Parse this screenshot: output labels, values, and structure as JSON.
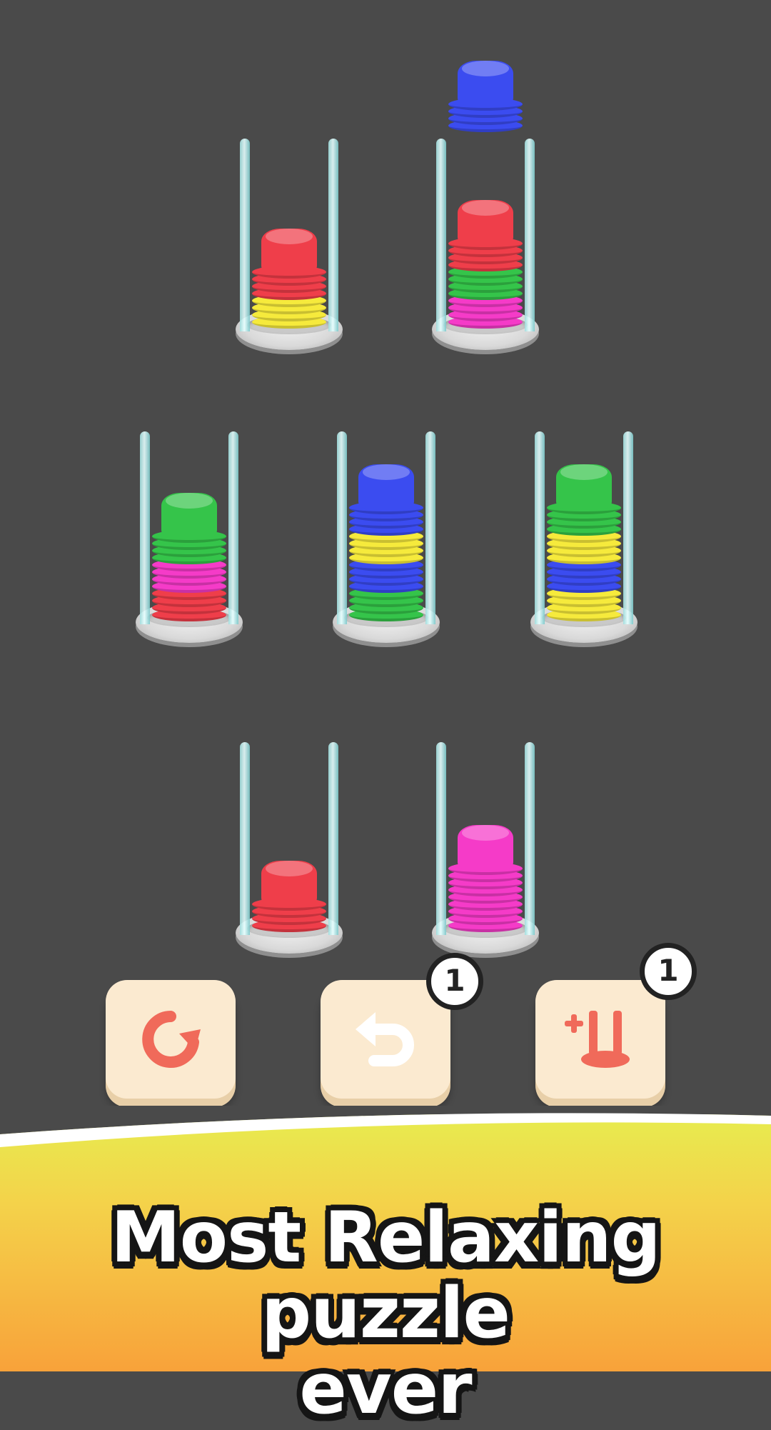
{
  "tagline": {
    "line1": "Most Relaxing puzzle",
    "line2": "ever"
  },
  "controls": {
    "restart_icon": "restart-icon",
    "undo_icon": "undo-icon",
    "undo_badge": "1",
    "add_tube_icon": "add-tube-icon",
    "add_tube_badge": "1"
  },
  "colors": {
    "background": "#4a4a4a",
    "red": "#ef3e4a",
    "yellow": "#f6ea3c",
    "green": "#35c44a",
    "magenta": "#f53bc8",
    "blue": "#3b4cf0",
    "button": "#fbead0",
    "icon": "#f06a5a"
  },
  "tubes": [
    {
      "id": "tube-1",
      "cups": [
        "yellow",
        "yellow",
        "yellow",
        "yellow",
        "red",
        "red",
        "red",
        "red"
      ]
    },
    {
      "id": "tube-2",
      "cups": [
        "magenta",
        "magenta",
        "magenta",
        "magenta",
        "green",
        "green",
        "green",
        "green",
        "red",
        "red",
        "red",
        "red"
      ]
    },
    {
      "id": "tube-3",
      "cups": [
        "red",
        "red",
        "red",
        "red",
        "magenta",
        "magenta",
        "magenta",
        "magenta",
        "green",
        "green",
        "green",
        "green"
      ]
    },
    {
      "id": "tube-4",
      "cups": [
        "green",
        "green",
        "green",
        "green",
        "blue",
        "blue",
        "blue",
        "blue",
        "yellow",
        "yellow",
        "yellow",
        "yellow",
        "blue",
        "blue",
        "blue",
        "blue"
      ]
    },
    {
      "id": "tube-5",
      "cups": [
        "yellow",
        "yellow",
        "yellow",
        "yellow",
        "blue",
        "blue",
        "blue",
        "blue",
        "yellow",
        "yellow",
        "yellow",
        "yellow",
        "green",
        "green",
        "green",
        "green"
      ]
    },
    {
      "id": "tube-6",
      "cups": [
        "red",
        "red",
        "red",
        "red"
      ]
    },
    {
      "id": "tube-7",
      "cups": [
        "magenta",
        "magenta",
        "magenta",
        "magenta",
        "magenta",
        "magenta",
        "magenta",
        "magenta",
        "magenta"
      ]
    }
  ],
  "held_stack": {
    "id": "held-stack",
    "cups": [
      "blue",
      "blue",
      "blue",
      "blue"
    ]
  }
}
